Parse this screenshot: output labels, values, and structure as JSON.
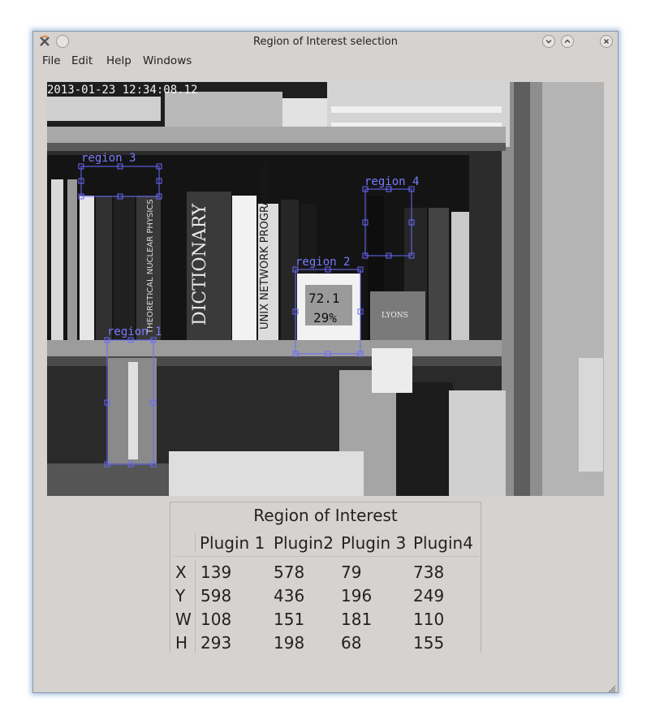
{
  "window": {
    "title": "Region of Interest selection"
  },
  "menu": [
    "File",
    "Edit",
    "Help",
    "Windows"
  ],
  "camera": {
    "timestamp": "2013-01-23 12:34:08.12",
    "regions": [
      "region 3",
      "region 4",
      "region 2",
      "region 1"
    ],
    "book_spines": [
      "DICTIONARY",
      "UNIX NETWORK PROGRAMMING",
      "THEORETICAL NUCLEAR PHYSICS",
      "LYONS"
    ],
    "display_temp": "72.1",
    "display_humidity": "29%"
  },
  "roi_table": {
    "title": "Region of Interest",
    "headers": [
      "",
      "Plugin 1",
      "Plugin2",
      "Plugin 3",
      "Plugin4"
    ],
    "rows": [
      {
        "label": "X",
        "values": [
          "139",
          "578",
          "79",
          "738"
        ]
      },
      {
        "label": "Y",
        "values": [
          "598",
          "436",
          "196",
          "249"
        ]
      },
      {
        "label": "W",
        "values": [
          "108",
          "151",
          "181",
          "110"
        ]
      },
      {
        "label": "H",
        "values": [
          "293",
          "198",
          "68",
          "155"
        ]
      }
    ]
  },
  "colors": {
    "window_bg": "#d6d2d0",
    "region_box": "#6a6aff",
    "focus_glow": "#5a8cc8"
  },
  "icons": [
    "app-icon",
    "shade-icon",
    "minimize-icon",
    "maximize-icon",
    "close-icon",
    "resize-grip-icon"
  ]
}
